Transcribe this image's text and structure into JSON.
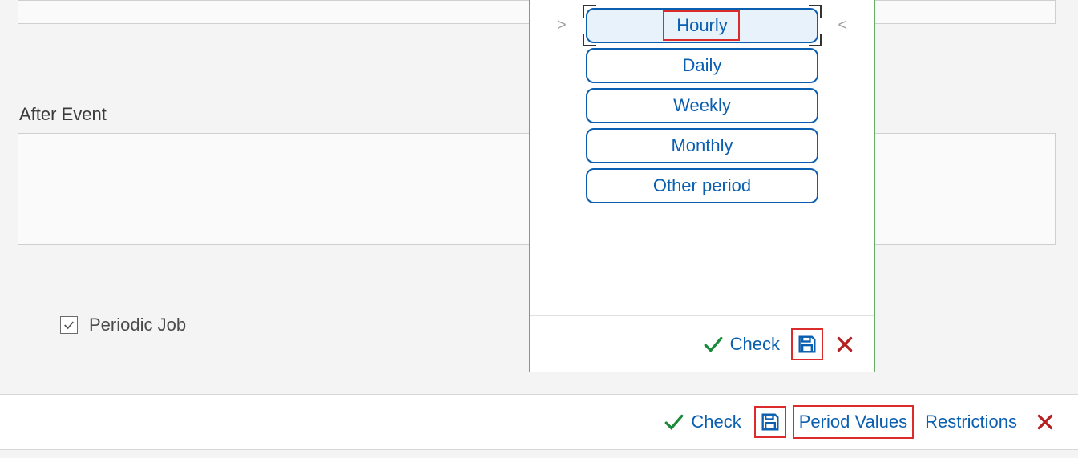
{
  "sections": {
    "after_event_label": "After Event"
  },
  "periodic": {
    "label": "Periodic Job",
    "checked": true
  },
  "popup": {
    "options": [
      {
        "label": "Hourly",
        "selected": true
      },
      {
        "label": "Daily",
        "selected": false
      },
      {
        "label": "Weekly",
        "selected": false
      },
      {
        "label": "Monthly",
        "selected": false
      },
      {
        "label": "Other period",
        "selected": false
      }
    ],
    "footer": {
      "check_label": "Check"
    }
  },
  "bottom_bar": {
    "check_label": "Check",
    "period_values_label": "Period Values",
    "restrictions_label": "Restrictions"
  },
  "icons": {
    "checkmark": "checkmark-icon",
    "save": "save-icon",
    "close": "close-icon"
  },
  "colors": {
    "accent": "#0a5fb0",
    "success": "#1a8a3a",
    "danger": "#b62020",
    "highlight": "#dc2b2b"
  }
}
